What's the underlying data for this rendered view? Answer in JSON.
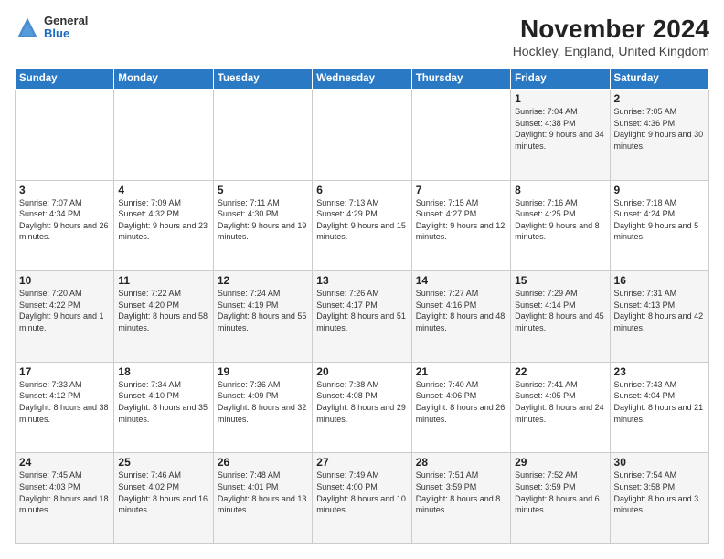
{
  "header": {
    "title": "November 2024",
    "subtitle": "Hockley, England, United Kingdom",
    "logo_general": "General",
    "logo_blue": "Blue"
  },
  "weekdays": [
    "Sunday",
    "Monday",
    "Tuesday",
    "Wednesday",
    "Thursday",
    "Friday",
    "Saturday"
  ],
  "weeks": [
    [
      {
        "day": "",
        "info": ""
      },
      {
        "day": "",
        "info": ""
      },
      {
        "day": "",
        "info": ""
      },
      {
        "day": "",
        "info": ""
      },
      {
        "day": "",
        "info": ""
      },
      {
        "day": "1",
        "info": "Sunrise: 7:04 AM\nSunset: 4:38 PM\nDaylight: 9 hours\nand 34 minutes."
      },
      {
        "day": "2",
        "info": "Sunrise: 7:05 AM\nSunset: 4:36 PM\nDaylight: 9 hours\nand 30 minutes."
      }
    ],
    [
      {
        "day": "3",
        "info": "Sunrise: 7:07 AM\nSunset: 4:34 PM\nDaylight: 9 hours\nand 26 minutes."
      },
      {
        "day": "4",
        "info": "Sunrise: 7:09 AM\nSunset: 4:32 PM\nDaylight: 9 hours\nand 23 minutes."
      },
      {
        "day": "5",
        "info": "Sunrise: 7:11 AM\nSunset: 4:30 PM\nDaylight: 9 hours\nand 19 minutes."
      },
      {
        "day": "6",
        "info": "Sunrise: 7:13 AM\nSunset: 4:29 PM\nDaylight: 9 hours\nand 15 minutes."
      },
      {
        "day": "7",
        "info": "Sunrise: 7:15 AM\nSunset: 4:27 PM\nDaylight: 9 hours\nand 12 minutes."
      },
      {
        "day": "8",
        "info": "Sunrise: 7:16 AM\nSunset: 4:25 PM\nDaylight: 9 hours\nand 8 minutes."
      },
      {
        "day": "9",
        "info": "Sunrise: 7:18 AM\nSunset: 4:24 PM\nDaylight: 9 hours\nand 5 minutes."
      }
    ],
    [
      {
        "day": "10",
        "info": "Sunrise: 7:20 AM\nSunset: 4:22 PM\nDaylight: 9 hours\nand 1 minute."
      },
      {
        "day": "11",
        "info": "Sunrise: 7:22 AM\nSunset: 4:20 PM\nDaylight: 8 hours\nand 58 minutes."
      },
      {
        "day": "12",
        "info": "Sunrise: 7:24 AM\nSunset: 4:19 PM\nDaylight: 8 hours\nand 55 minutes."
      },
      {
        "day": "13",
        "info": "Sunrise: 7:26 AM\nSunset: 4:17 PM\nDaylight: 8 hours\nand 51 minutes."
      },
      {
        "day": "14",
        "info": "Sunrise: 7:27 AM\nSunset: 4:16 PM\nDaylight: 8 hours\nand 48 minutes."
      },
      {
        "day": "15",
        "info": "Sunrise: 7:29 AM\nSunset: 4:14 PM\nDaylight: 8 hours\nand 45 minutes."
      },
      {
        "day": "16",
        "info": "Sunrise: 7:31 AM\nSunset: 4:13 PM\nDaylight: 8 hours\nand 42 minutes."
      }
    ],
    [
      {
        "day": "17",
        "info": "Sunrise: 7:33 AM\nSunset: 4:12 PM\nDaylight: 8 hours\nand 38 minutes."
      },
      {
        "day": "18",
        "info": "Sunrise: 7:34 AM\nSunset: 4:10 PM\nDaylight: 8 hours\nand 35 minutes."
      },
      {
        "day": "19",
        "info": "Sunrise: 7:36 AM\nSunset: 4:09 PM\nDaylight: 8 hours\nand 32 minutes."
      },
      {
        "day": "20",
        "info": "Sunrise: 7:38 AM\nSunset: 4:08 PM\nDaylight: 8 hours\nand 29 minutes."
      },
      {
        "day": "21",
        "info": "Sunrise: 7:40 AM\nSunset: 4:06 PM\nDaylight: 8 hours\nand 26 minutes."
      },
      {
        "day": "22",
        "info": "Sunrise: 7:41 AM\nSunset: 4:05 PM\nDaylight: 8 hours\nand 24 minutes."
      },
      {
        "day": "23",
        "info": "Sunrise: 7:43 AM\nSunset: 4:04 PM\nDaylight: 8 hours\nand 21 minutes."
      }
    ],
    [
      {
        "day": "24",
        "info": "Sunrise: 7:45 AM\nSunset: 4:03 PM\nDaylight: 8 hours\nand 18 minutes."
      },
      {
        "day": "25",
        "info": "Sunrise: 7:46 AM\nSunset: 4:02 PM\nDaylight: 8 hours\nand 16 minutes."
      },
      {
        "day": "26",
        "info": "Sunrise: 7:48 AM\nSunset: 4:01 PM\nDaylight: 8 hours\nand 13 minutes."
      },
      {
        "day": "27",
        "info": "Sunrise: 7:49 AM\nSunset: 4:00 PM\nDaylight: 8 hours\nand 10 minutes."
      },
      {
        "day": "28",
        "info": "Sunrise: 7:51 AM\nSunset: 3:59 PM\nDaylight: 8 hours\nand 8 minutes."
      },
      {
        "day": "29",
        "info": "Sunrise: 7:52 AM\nSunset: 3:59 PM\nDaylight: 8 hours\nand 6 minutes."
      },
      {
        "day": "30",
        "info": "Sunrise: 7:54 AM\nSunset: 3:58 PM\nDaylight: 8 hours\nand 3 minutes."
      }
    ]
  ]
}
